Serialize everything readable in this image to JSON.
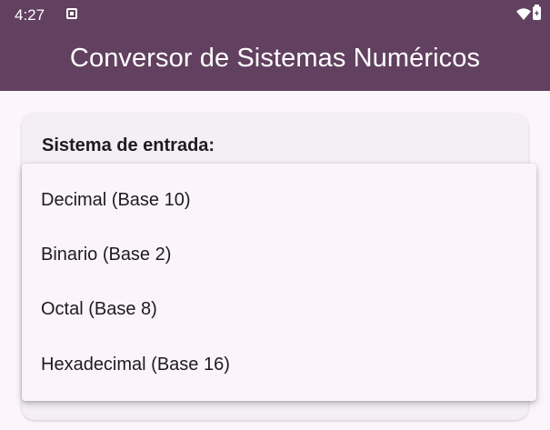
{
  "status_bar": {
    "time": "4:27",
    "notification_icon": "notification-icon",
    "wifi_icon": "wifi-icon",
    "battery_icon": "battery-charging-icon"
  },
  "app_bar": {
    "title": "Conversor de Sistemas Numéricos",
    "background": "#62405f"
  },
  "card": {
    "label": "Sistema de entrada:"
  },
  "dropdown": {
    "options": [
      "Decimal (Base 10)",
      "Binario (Base 2)",
      "Octal (Base 8)",
      "Hexadecimal (Base 16)"
    ]
  }
}
